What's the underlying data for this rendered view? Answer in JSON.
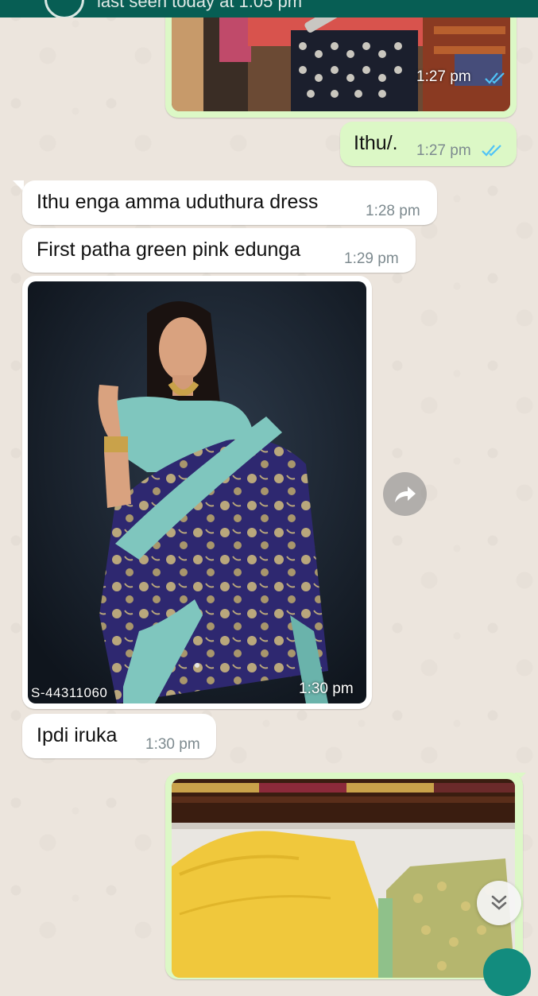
{
  "header": {
    "status_text": "last seen today at 1:05 pm"
  },
  "messages": [
    {
      "direction": "out",
      "kind": "image",
      "time": "1:27 pm",
      "status": "read"
    },
    {
      "direction": "out",
      "kind": "text",
      "text": "Ithu/.",
      "time": "1:27 pm",
      "status": "read"
    },
    {
      "direction": "in",
      "kind": "text",
      "text": "Ithu enga amma uduthura dress",
      "time": "1:28 pm"
    },
    {
      "direction": "in",
      "kind": "text",
      "text": "First patha green pink edunga",
      "time": "1:29 pm"
    },
    {
      "direction": "in",
      "kind": "image",
      "caption_overlay": "S-44311060",
      "time": "1:30 pm"
    },
    {
      "direction": "in",
      "kind": "text",
      "text": "Ipdi iruka",
      "time": "1:30 pm"
    },
    {
      "direction": "out",
      "kind": "image"
    }
  ],
  "icons": {
    "read_receipt": "double-check-icon",
    "forward": "forward-icon",
    "scroll_down": "double-chevron-down-icon"
  },
  "colors": {
    "header": "#075e54",
    "outgoing_bubble": "#dcf8c6",
    "incoming_bubble": "#ffffff",
    "read_tick": "#4fc3f7",
    "chat_background": "#ece5dd"
  }
}
